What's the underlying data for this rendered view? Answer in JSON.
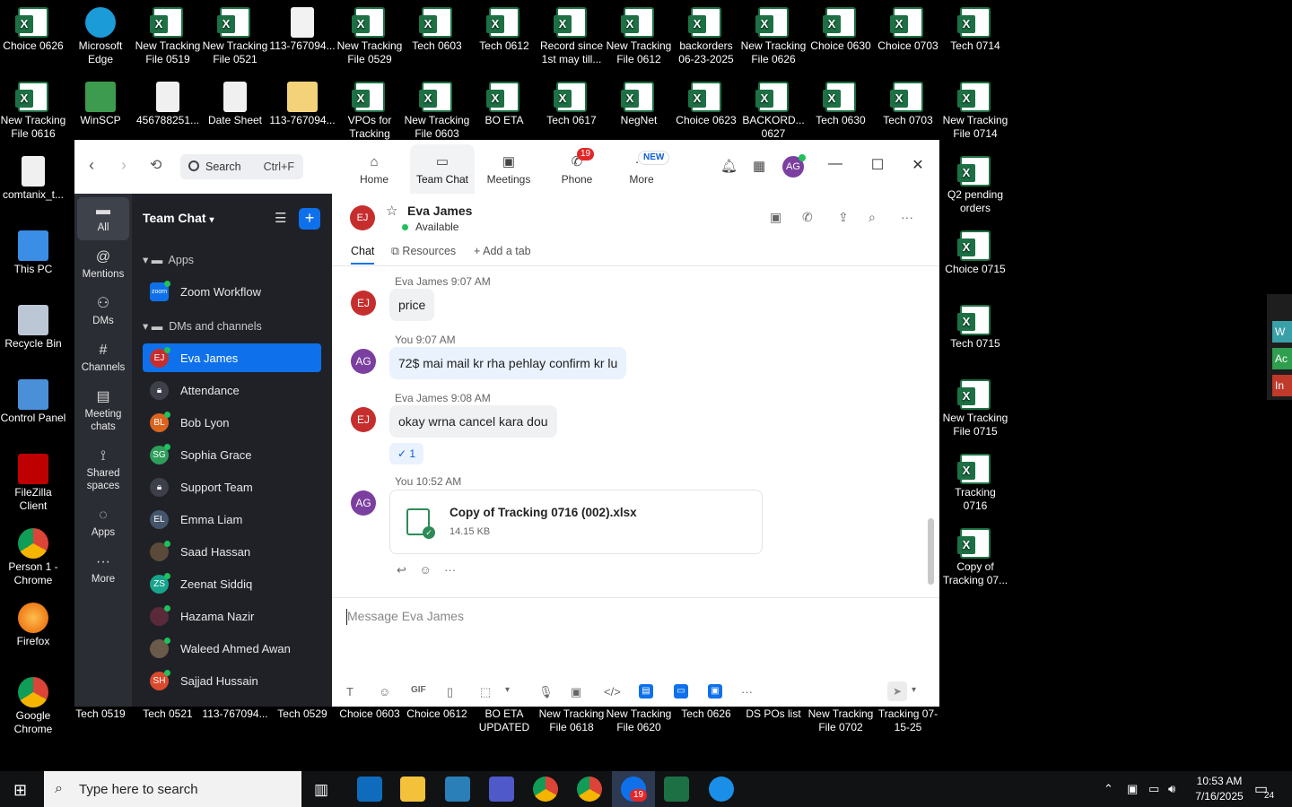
{
  "desktop": {
    "icons_row1": [
      "Choice 0626",
      "Microsoft Edge",
      "New Tracking File 0519",
      "New Tracking File 0521",
      "113-767094...",
      "New Tracking File 0529",
      "Tech 0603",
      "Tech 0612",
      "Record since 1st may till...",
      "New Tracking File 0612",
      "backorders 06-23-2025",
      "New Tracking File 0626",
      "Choice 0630",
      "Choice 0703",
      "Tech 0714"
    ],
    "icons_row2": [
      "New Tracking File 0616",
      "WinSCP",
      "456788251...",
      "Date Sheet",
      "113-767094...",
      "VPOs for Tracking",
      "New Tracking File 0603",
      "BO ETA",
      "Tech 0617",
      "NegNet",
      "Choice 0623",
      "BACKORD... 0627",
      "Tech 0630",
      "Tech 0703",
      "New Tracking File 0714"
    ],
    "icons_left": [
      "comtanix_t...",
      "This PC",
      "Recycle Bin",
      "Control Panel",
      "FileZilla Client",
      "Person 1 - Chrome",
      "Firefox",
      "Google Chrome"
    ],
    "icons_right": [
      "Q2 pending orders",
      "Choice 0715",
      "Tech 0715",
      "New Tracking File 0715",
      "Tracking 0716",
      "Copy of Tracking 07..."
    ],
    "icons_bottom": [
      "Tech 0519",
      "Tech 0521",
      "113-767094...",
      "Tech 0529",
      "Choice 0603",
      "Choice 0612",
      "BO ETA UPDATED",
      "New Tracking File 0618",
      "New Tracking File 0620",
      "Tech 0626",
      "DS POs list",
      "New Tracking File 0702",
      "Tracking 07-15-25"
    ],
    "edge_bar": [
      "W",
      "Ac",
      "In"
    ]
  },
  "zoom": {
    "search": {
      "placeholder": "Search",
      "shortcut": "Ctrl+F"
    },
    "tabs": [
      {
        "label": "Home",
        "icon": "home-icon"
      },
      {
        "label": "Team Chat",
        "icon": "chat-icon"
      },
      {
        "label": "Meetings",
        "icon": "video-icon"
      },
      {
        "label": "Phone",
        "icon": "phone-icon",
        "badge": "19"
      },
      {
        "label": "More",
        "icon": "more-icon",
        "badge": "NEW"
      }
    ],
    "user_avatar": "AG",
    "rail": [
      "All",
      "Mentions",
      "DMs",
      "Channels",
      "Meeting chats",
      "Shared spaces",
      "Apps",
      "More"
    ],
    "sidebar": {
      "title": "Team Chat",
      "group_apps": "Apps",
      "app_item": "Zoom Workflow",
      "app_logo": "zoom",
      "group_dms": "DMs and channels",
      "items": [
        {
          "initials": "EJ",
          "name": "Eva James",
          "color": "#c62e2e"
        },
        {
          "initials": "",
          "name": "Attendance",
          "color": "#3d4048"
        },
        {
          "initials": "BL",
          "name": "Bob Lyon",
          "color": "#d9641e"
        },
        {
          "initials": "SG",
          "name": "Sophia Grace",
          "color": "#2e9e5a"
        },
        {
          "initials": "",
          "name": "Support Team",
          "color": "#3d4048"
        },
        {
          "initials": "EL",
          "name": "Emma Liam",
          "color": "#44546a"
        },
        {
          "initials": "",
          "name": "Saad Hassan",
          "color": "#5a4a3a"
        },
        {
          "initials": "ZS",
          "name": "Zeenat Siddiq",
          "color": "#18a48c"
        },
        {
          "initials": "",
          "name": "Hazama Nazir",
          "color": "#5a2a3a"
        },
        {
          "initials": "",
          "name": "Waleed Ahmed Awan",
          "color": "#6a5a4a"
        },
        {
          "initials": "SH",
          "name": "Sajjad Hussain",
          "color": "#d94a2e"
        }
      ]
    },
    "chat": {
      "contact_initials": "EJ",
      "contact_name": "Eva James",
      "status": "Available",
      "tabs": [
        "Chat",
        "Resources",
        "Add a tab"
      ],
      "messages": [
        {
          "sender": "Eva James",
          "time": "9:07 AM",
          "initials": "EJ",
          "text": "price"
        },
        {
          "sender": "You",
          "time": "9:07 AM",
          "initials": "AG",
          "text": "72$ mai mail kr rha pehlay confirm kr lu"
        },
        {
          "sender": "Eva James",
          "time": "9:08 AM",
          "initials": "EJ",
          "text": "okay wrna cancel kara dou"
        },
        {
          "sender": "You",
          "time": "10:52 AM",
          "initials": "AG",
          "text": ""
        }
      ],
      "reaction": "✓ 1",
      "file": {
        "name": "Copy of Tracking 0716 (002).xlsx",
        "size": "14.15 KB"
      },
      "composer_placeholder": "Message Eva James"
    }
  },
  "taskbar": {
    "search_placeholder": "Type here to search",
    "zoom_badge": "19",
    "time": "10:53 AM",
    "date": "7/16/2025",
    "notifications": "24"
  }
}
